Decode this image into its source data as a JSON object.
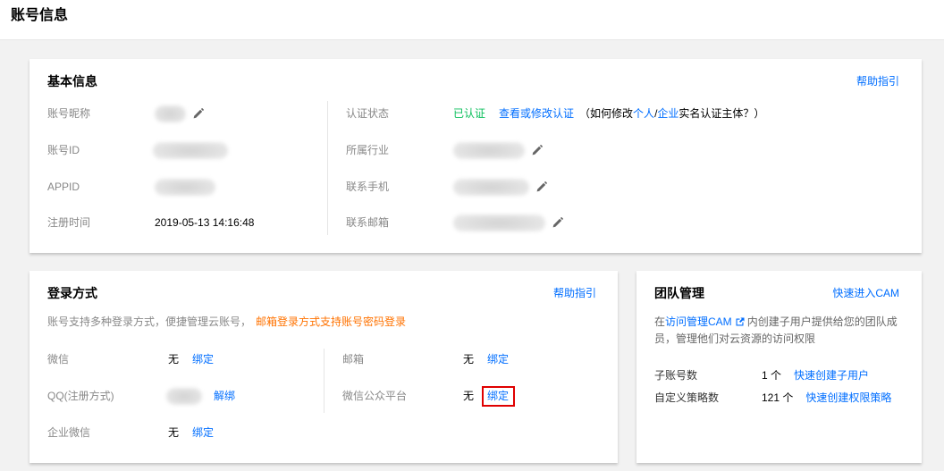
{
  "theme": {
    "link_color": "#006eff",
    "success_color": "#0abf5b",
    "warning_color": "#ff7200",
    "highlight_color": "#e00000",
    "page_background": "#f2f2f2"
  },
  "header": {
    "title": "账号信息"
  },
  "basic_info": {
    "title": "基本信息",
    "help_link": "帮助指引",
    "nickname": {
      "label": "账号昵称",
      "icon": "edit-icon"
    },
    "account_id": {
      "label": "账号ID"
    },
    "appid": {
      "label": "APPID"
    },
    "registered_at": {
      "label": "注册时间",
      "value": "2019-05-13 14:16:48"
    },
    "verification": {
      "label": "认证状态",
      "status": "已认证",
      "action_link": "查看或修改认证",
      "hint_open": "（如何修改",
      "hint_personal_link": "个人",
      "hint_separator": "/",
      "hint_enterprise_link": "企业",
      "hint_close": "实名认证主体？）"
    },
    "industry": {
      "label": "所属行业",
      "icon": "edit-icon"
    },
    "phone": {
      "label": "联系手机",
      "icon": "edit-icon"
    },
    "email": {
      "label": "联系邮箱",
      "icon": "edit-icon"
    }
  },
  "login_methods": {
    "title": "登录方式",
    "help_link": "帮助指引",
    "description": "账号支持多种登录方式，便捷管理云账号，",
    "description_highlight": "邮箱登录方式支持账号密码登录",
    "left_items": [
      {
        "label": "微信",
        "status": "无",
        "action": "绑定"
      },
      {
        "label": "QQ(注册方式)",
        "action": "解绑"
      },
      {
        "label": "企业微信",
        "status": "无",
        "action": "绑定"
      }
    ],
    "right_items": [
      {
        "label": "邮箱",
        "status": "无",
        "action": "绑定"
      },
      {
        "label": "微信公众平台",
        "status": "无",
        "action": "绑定"
      }
    ]
  },
  "team": {
    "title": "团队管理",
    "quick_link": "快速进入CAM",
    "description_prefix": "在",
    "description_link": "访问管理CAM",
    "description_link_icon": "external-link-icon",
    "description_rest": "内创建子用户提供给您的团队成员，管理他们对云资源的访问权限",
    "stats": [
      {
        "label": "子账号数",
        "value": "1 个",
        "action": "快速创建子用户"
      },
      {
        "label": "自定义策略数",
        "value": "121 个",
        "action": "快速创建权限策略"
      }
    ]
  }
}
